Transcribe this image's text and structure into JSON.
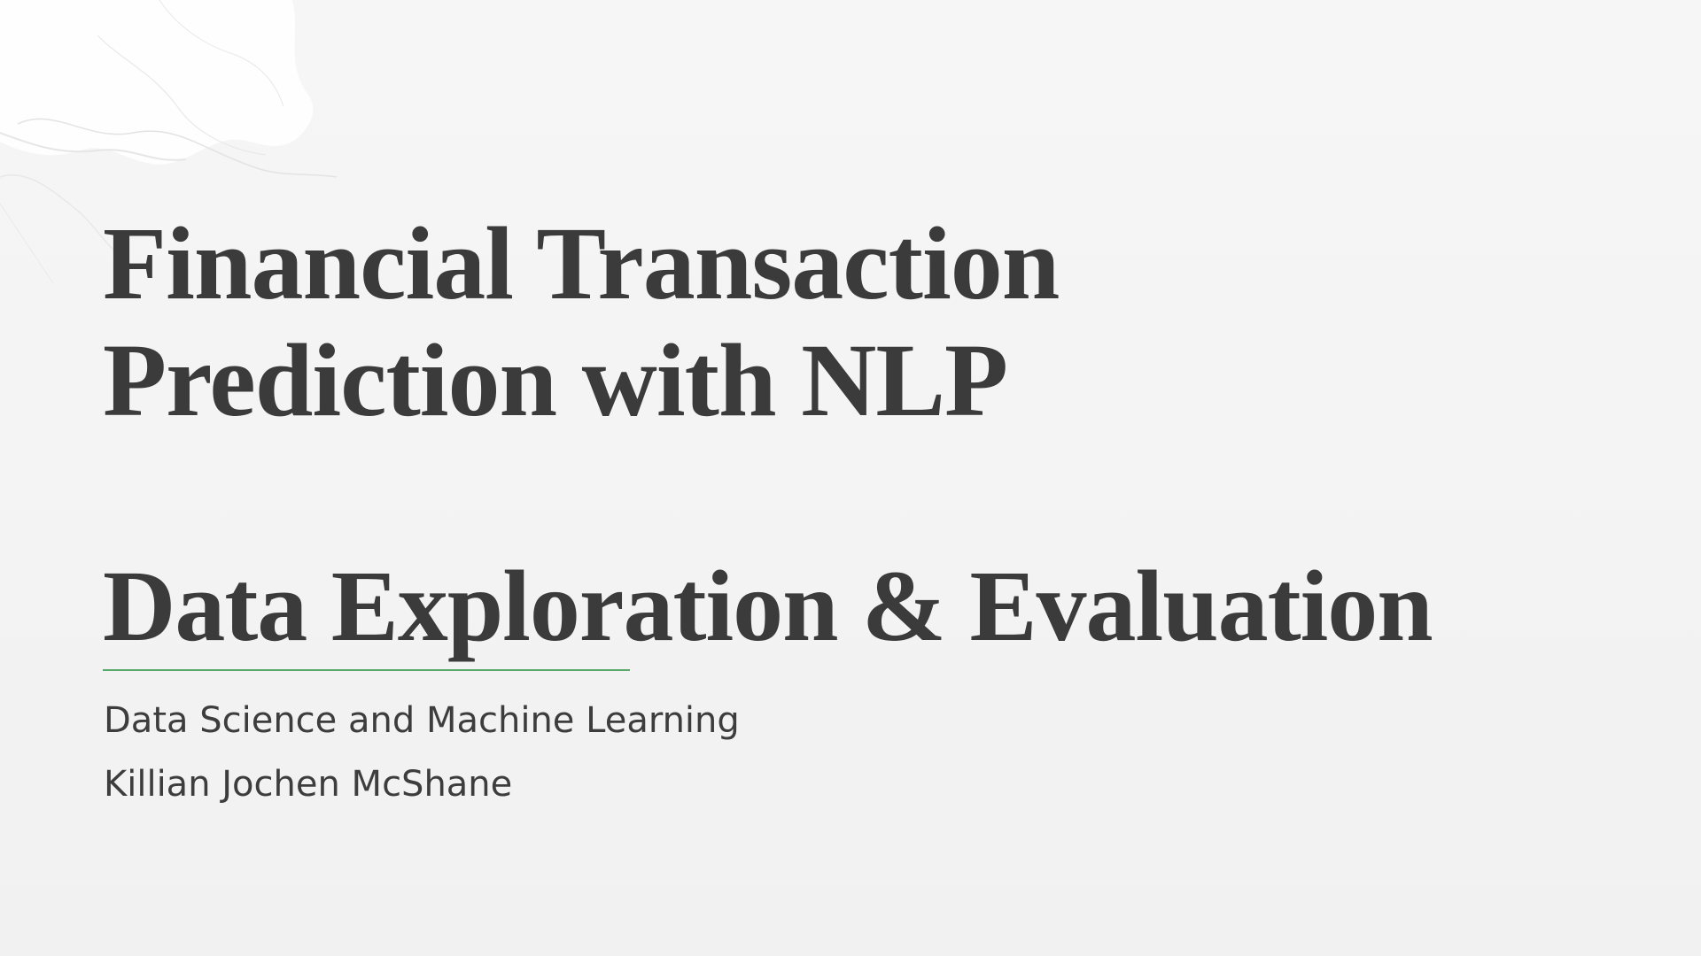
{
  "slide": {
    "title_lines": [
      "Financial Transaction",
      "Prediction with NLP"
    ],
    "heading": "Data Exploration & Evaluation",
    "course": "Data Science and Machine Learning",
    "author": "Killian Jochen McShane"
  },
  "colors": {
    "background": "#f4f4f4",
    "text": "#3b3b3b",
    "accent_line": "#5aa86a"
  },
  "icons": {
    "background_texture": "marble-texture-decoration"
  }
}
